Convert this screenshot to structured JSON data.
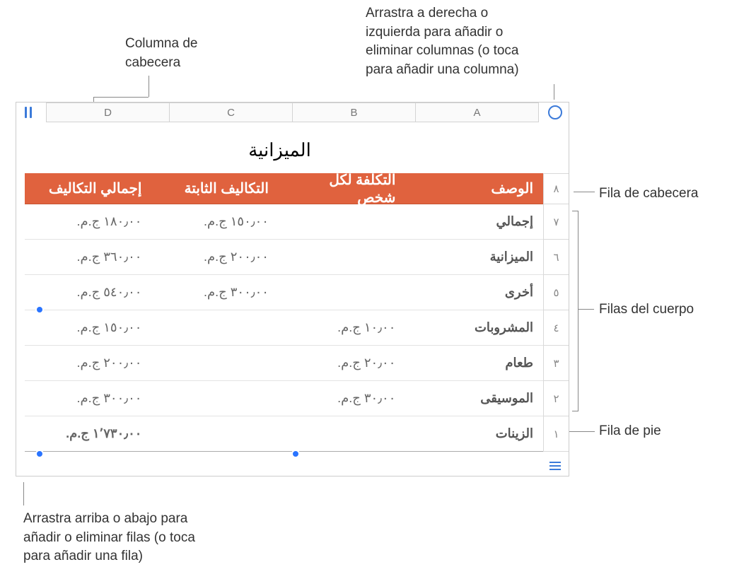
{
  "callouts": {
    "column_header": "Columna de\ncabecera",
    "drag_columns": "Arrastra a derecha o\nizquierda para añadir o\neliminar columnas (o toca\npara añadir una columna)",
    "header_row": "Fila de cabecera",
    "body_rows": "Filas del cuerpo",
    "footer_row": "Fila de pie",
    "drag_rows": "Arrastra arriba o abajo para\nañadir o eliminar filas (o toca\npara añadir una fila)"
  },
  "table": {
    "title": "الميزانية",
    "column_letters": [
      "A",
      "B",
      "C",
      "D"
    ],
    "row_numbers": [
      "٨",
      "٧",
      "٦",
      "٥",
      "٤",
      "٣",
      "٢",
      "١"
    ],
    "header": {
      "desc": "الوصف",
      "per_person": "التكلفة لكل شخص",
      "fixed": "التكاليف الثابتة",
      "total_costs": "إجمالي التكاليف"
    },
    "rows": [
      {
        "desc": "إجمالي",
        "per_person": "",
        "fixed": "١٥٠٫٠٠ ج.م.",
        "total": "١٨٠٫٠٠ ج.م."
      },
      {
        "desc": "الميزانية",
        "per_person": "",
        "fixed": "٢٠٠٫٠٠ ج.م.",
        "total": "٣٦٠٫٠٠ ج.م."
      },
      {
        "desc": "أخرى",
        "per_person": "",
        "fixed": "٣٠٠٫٠٠ ج.م.",
        "total": "٥٤٠٫٠٠ ج.م."
      },
      {
        "desc": "المشروبات",
        "per_person": "١٠٫٠٠ ج.م.",
        "fixed": "",
        "total": "١٥٠٫٠٠ ج.م."
      },
      {
        "desc": "طعام",
        "per_person": "٢٠٫٠٠ ج.م.",
        "fixed": "",
        "total": "٢٠٠٫٠٠ ج.م."
      },
      {
        "desc": "الموسيقى",
        "per_person": "٣٠٫٠٠ ج.م.",
        "fixed": "",
        "total": "٣٠٠٫٠٠ ج.م."
      }
    ],
    "footer": {
      "desc": "الزينات",
      "per_person": "",
      "fixed": "",
      "total": "١٬٧٣٠٫٠٠ ج.م."
    }
  }
}
